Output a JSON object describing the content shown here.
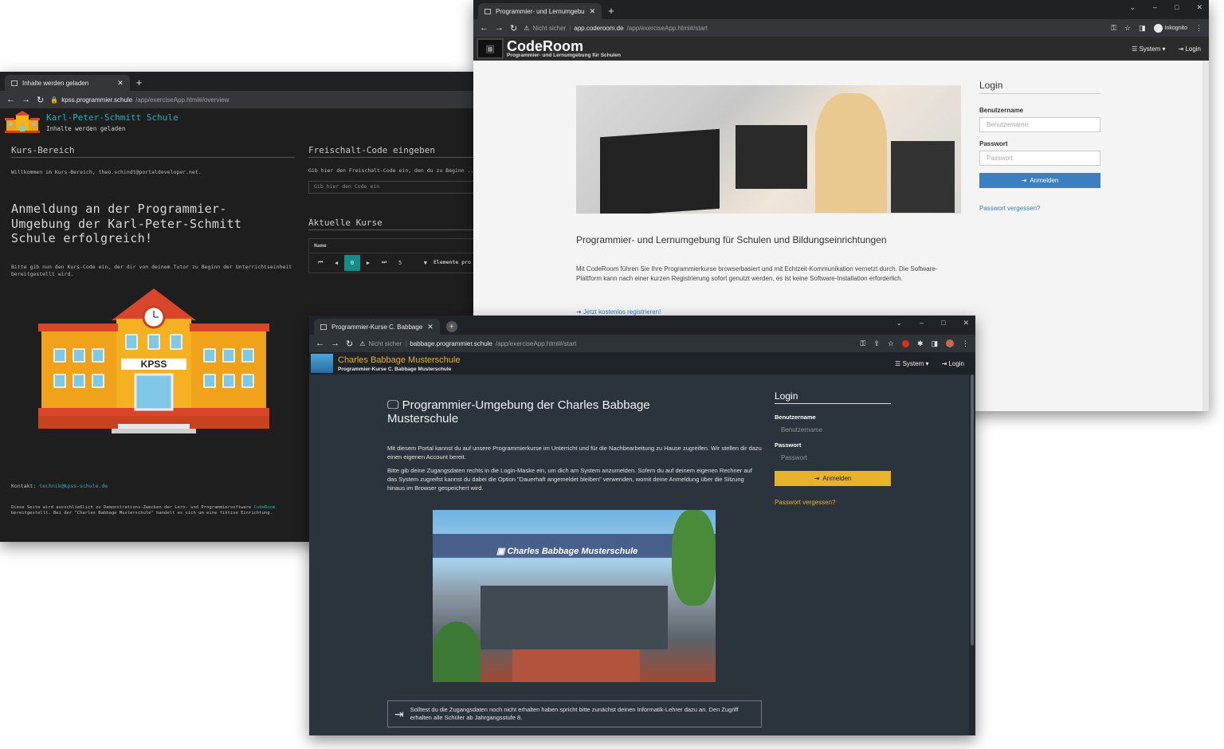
{
  "kpss": {
    "tab_title": "Inhalte werden geladen",
    "url_host": "kpss.programmier.schule",
    "url_path": "/app/exerciseApp.html#/overview",
    "title": "Karl-Peter-Schmitt Schule",
    "subtitle": "Inhalte werden geladen",
    "kurs_heading": "Kurs-Bereich",
    "welcome": "Willkommen im Kurs-Bereich, theo.schindt@portaldeveloper.net.",
    "big_message": "Anmeldung an der Programmier-Umgebung der Karl-Peter-Schmitt Schule erfolgreich!",
    "instruction": "Bitte gib nun den Kurs-Code ein, der dir von deinem Tutor zu Beginn der Unterrichtseinheit bereitgestellt wird.",
    "building_sign": "KPSS",
    "contact_label": "Kontakt:",
    "contact_email": "technik@kpss-schule.de",
    "disclaimer_1": "Diese Seite wird ausschließlich zu Demonstrations-Zwecken der Lern- und Programmiersoftware",
    "disclaimer_link": "CodeRoom",
    "disclaimer_2": "bereitgestellt. Bei der \"Charles Babbage Musterschule\" handelt es sich um eine fiktive Einrichtung.",
    "code_heading": "Freischalt-Code eingeben",
    "code_instruction": "Gib hier den Freischalt-Code ein, den du zu Beginn ...",
    "code_placeholder": "Gib hier den Code ein",
    "courses_heading": "Aktuelle Kurse",
    "table_column": "Name",
    "page_current": "0",
    "page_size": "5",
    "page_size_suffix": "Elemente pro Seite"
  },
  "coderoom": {
    "tab_title": "Programmier- und Lernumgebu",
    "url_security": "Nicht sicher",
    "url_host": "app.coderoom.de",
    "url_path": "/app/exerciseApp.html#/start",
    "profile_label": "Inkognito",
    "brand": "CodeRoom",
    "brand_sub": "Programmier- und Lernumgebung für Schulen",
    "menu_system": "System",
    "menu_login": "Login",
    "headline": "Programmier- und Lernumgebung für Schulen und Bildungseinrichtungen",
    "description": "Mit CodeRoom führen Sie Ihre Programmierkurse browserbasiert und mit Echtzeit-Kommunikation vernetzt durch. Die Software-Plattform kann nach einer kurzen Registrierung sofort genutzt werden, es ist keine Software-Installation erforderlich.",
    "register_link": "Jetzt kostenlos registrieren!",
    "login_title": "Login",
    "username_label": "Benutzername",
    "username_placeholder": "Benutzername",
    "password_label": "Passwort",
    "password_placeholder": "Passwort",
    "submit": "Anmelden",
    "forgot": "Passwort vergessen?",
    "accent": "#3a7fc1"
  },
  "babbage": {
    "tab_title": "Programmier-Kurse C. Babbage",
    "url_security": "Nicht sicher",
    "url_host": "babbage.programmier.schule",
    "url_path": "/app/exerciseApp.html#/start",
    "brand": "Charles Babbage Musterschule",
    "brand_sub": "Programmier-Kurse C. Babbage Musterschule",
    "menu_system": "System",
    "menu_login": "Login",
    "headline": "Programmier-Umgebung der Charles Babbage Musterschule",
    "para1": "Mit diesem Portal kannst du auf unsere Programmierkurse im Unterricht und für die Nachbearbeitung zu Hause zugreifen. Wir stellen dir dazu einen eigenen Account bereit.",
    "para2": "Bitte gib deine Zugangsdaten rechts in die Login-Maske ein, um dich am System anzumelden. Sofern du auf deinem eigenen Rechner auf das System zugreifst kannst du dabei die Option \"Dauerhaft angemeldet bleiben\" verwenden, womit deine Anmeldung über die Sitzung hinaus im Browser gespeichert wird.",
    "photo_sign": "Charles Babbage Musterschule",
    "notice": "Solltest du die Zugangsdaten noch nicht erhalten haben spricht bitte zunächst deinen Informatik-Lehrer dazu an. Den Zugriff erhalten alle Schüler ab Jahrgangsstufe 8.",
    "login_title": "Login",
    "username_label": "Benutzername",
    "username_placeholder": "Benutzername",
    "password_label": "Passwort",
    "password_placeholder": "Passwort",
    "submit": "Anmelden",
    "forgot": "Passwort vergessen?",
    "accent": "#e8b22a"
  }
}
